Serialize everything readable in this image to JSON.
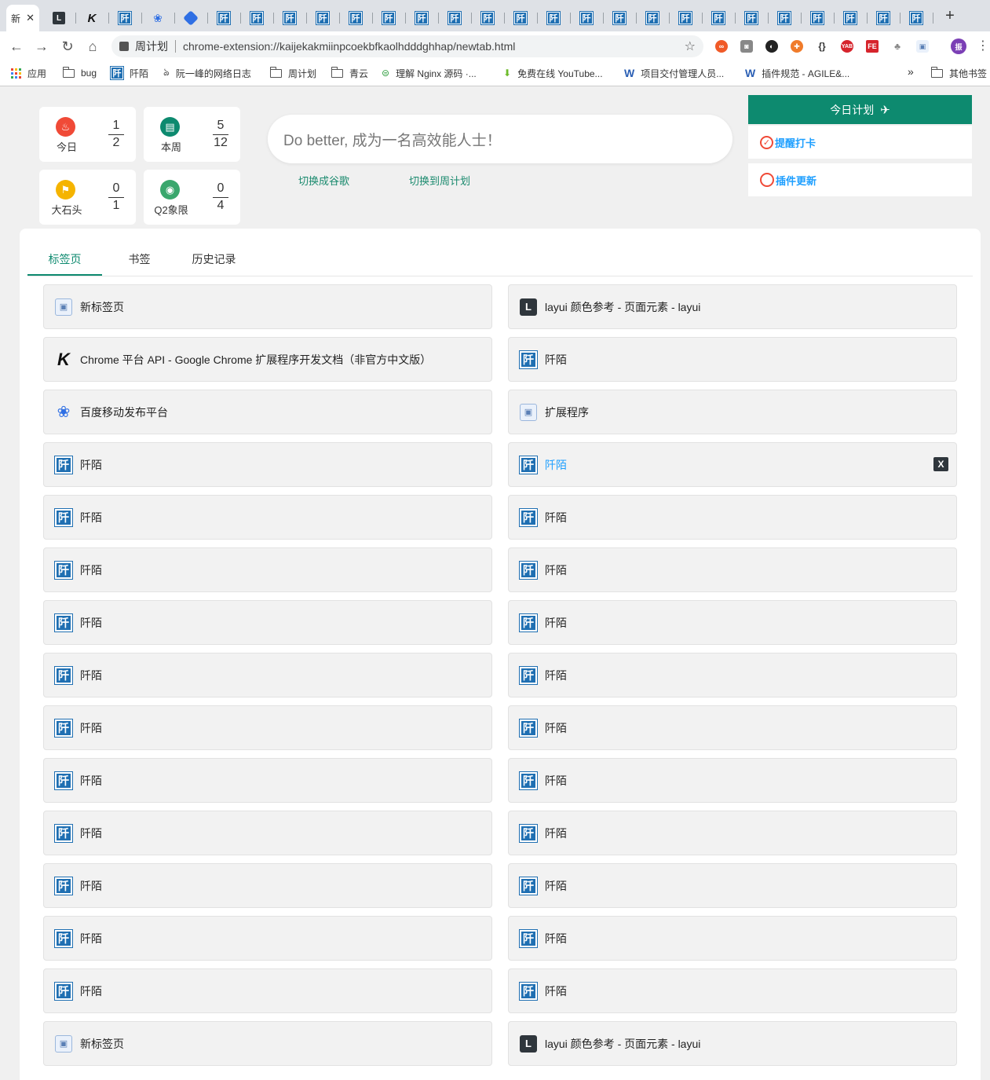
{
  "browser": {
    "active_tab": {
      "label": "新",
      "close": "✕"
    },
    "tab_favicons": [
      "layui",
      "k",
      "pm",
      "paw",
      "puzzle",
      "pm",
      "pm",
      "pm",
      "pm",
      "pm",
      "pm",
      "pm",
      "pm",
      "pm",
      "pm",
      "pm",
      "pm",
      "pm",
      "pm",
      "pm",
      "pm",
      "pm",
      "pm",
      "pm",
      "pm",
      "pm",
      "pm"
    ],
    "pm_glyph": "阡",
    "layui_glyph": "L",
    "k_glyph": "K",
    "new_tab": "+",
    "omnibox": {
      "page_title": "周计划",
      "url": "chrome-extension://kaijekakmiinpcoekbfkaolhdddghhap/newtab.html",
      "star": "☆"
    },
    "nav": {
      "back": "←",
      "forward": "→",
      "reload": "↻",
      "home": "⌂"
    },
    "menu": "⋮"
  },
  "bookmarks": [
    {
      "label": "应用",
      "icon": "apps-grid-icon"
    },
    {
      "label": "bug",
      "icon": "folder-icon"
    },
    {
      "label": "阡陌",
      "icon": "qianmo-icon"
    },
    {
      "label": "阮一峰的网络日志",
      "icon": "ruanyifeng-icon"
    },
    {
      "label": "周计划",
      "icon": "folder-icon"
    },
    {
      "label": "青云",
      "icon": "folder-icon"
    },
    {
      "label": "理解 Nginx 源码 ·...",
      "icon": "nginx-icon"
    },
    {
      "label": "免费在线 YouTube...",
      "icon": "download-icon"
    },
    {
      "label": "项目交付管理人员...",
      "icon": "w-icon"
    },
    {
      "label": "插件规范 - AGILE&...",
      "icon": "w-icon"
    }
  ],
  "bookmarks_more": "»",
  "other_bookmarks": "其他书签",
  "stats": [
    {
      "label": "今日",
      "num": "1",
      "den": "2",
      "icon": "fire-icon",
      "color": "#f04a37",
      "glyph": "♨"
    },
    {
      "label": "本周",
      "num": "5",
      "den": "12",
      "icon": "note-icon",
      "color": "#0d8a6f",
      "glyph": "▤"
    },
    {
      "label": "大石头",
      "num": "0",
      "den": "1",
      "icon": "flag-icon",
      "color": "#f5b400",
      "glyph": "⚑"
    },
    {
      "label": "Q2象限",
      "num": "0",
      "den": "4",
      "icon": "palette-icon",
      "color": "#3aa76d",
      "glyph": "◉"
    }
  ],
  "motto": "Do better, 成为一名高效能人士！",
  "switch_links": {
    "google": "切换成谷歌",
    "weekly": "切换到周计划"
  },
  "plan_button": {
    "label": "今日计划",
    "icon": "✈"
  },
  "side_items": {
    "reminder": "提醒打卡",
    "update": "插件更新",
    "check": "✓"
  },
  "main_tabs": [
    "标签页",
    "书签",
    "历史记录"
  ],
  "close_label": "X",
  "cards": [
    {
      "text": "新标签页",
      "fav": "newtab"
    },
    {
      "text": "layui 颜色参考 - 页面元素 - layui",
      "fav": "layui"
    },
    {
      "text": "Chrome 平台 API - Google Chrome 扩展程序开发文档（非官方中文版）",
      "fav": "k"
    },
    {
      "text": "阡陌",
      "fav": "pm"
    },
    {
      "text": "百度移动发布平台",
      "fav": "paw"
    },
    {
      "text": "扩展程序",
      "fav": "newtab"
    },
    {
      "text": "阡陌",
      "fav": "pm"
    },
    {
      "text": "阡陌",
      "fav": "pm",
      "hover": true
    },
    {
      "text": "阡陌",
      "fav": "pm"
    },
    {
      "text": "阡陌",
      "fav": "pm"
    },
    {
      "text": "阡陌",
      "fav": "pm"
    },
    {
      "text": "阡陌",
      "fav": "pm"
    },
    {
      "text": "阡陌",
      "fav": "pm"
    },
    {
      "text": "阡陌",
      "fav": "pm"
    },
    {
      "text": "阡陌",
      "fav": "pm"
    },
    {
      "text": "阡陌",
      "fav": "pm"
    },
    {
      "text": "阡陌",
      "fav": "pm"
    },
    {
      "text": "阡陌",
      "fav": "pm"
    },
    {
      "text": "阡陌",
      "fav": "pm"
    },
    {
      "text": "阡陌",
      "fav": "pm"
    },
    {
      "text": "阡陌",
      "fav": "pm"
    },
    {
      "text": "阡陌",
      "fav": "pm"
    },
    {
      "text": "阡陌",
      "fav": "pm"
    },
    {
      "text": "阡陌",
      "fav": "pm"
    },
    {
      "text": "阡陌",
      "fav": "pm"
    },
    {
      "text": "阡陌",
      "fav": "pm"
    },
    {
      "text": "阡陌",
      "fav": "pm"
    },
    {
      "text": "阡陌",
      "fav": "pm"
    },
    {
      "text": "新标签页",
      "fav": "newtab"
    },
    {
      "text": "layui 颜色参考 - 页面元素 - layui",
      "fav": "layui"
    }
  ]
}
